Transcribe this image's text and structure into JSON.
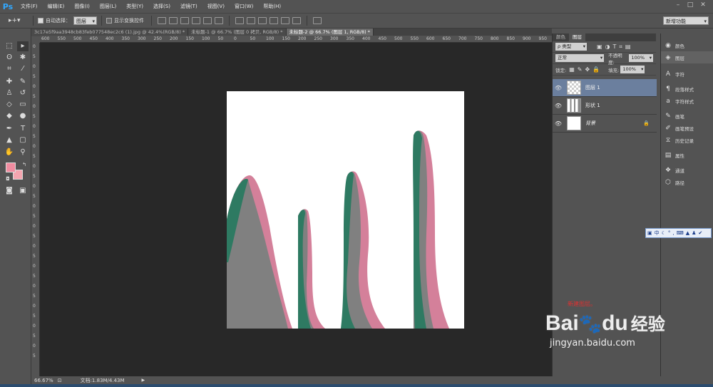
{
  "app": {
    "logo": "Ps"
  },
  "menu": [
    "文件(F)",
    "编辑(E)",
    "图像(I)",
    "图层(L)",
    "类型(Y)",
    "选择(S)",
    "滤镜(T)",
    "视图(V)",
    "窗口(W)",
    "帮助(H)"
  ],
  "options": {
    "auto_select_label": "自动选择：",
    "auto_select_value": "图层",
    "show_transform_label": "显示变换控件",
    "workspace": "新增功能"
  },
  "tabs": [
    {
      "label": "3c17e5f9aa3948cb83feb077548ec2c6 (1).jpg @ 42.4%(RGB/8) *"
    },
    {
      "label": "未标题-1 @ 66.7% (图层 0 拷贝, RGB/8) *"
    },
    {
      "label": "未标题-2 @ 66.7% (图层 1, RGB/8) *"
    }
  ],
  "ruler_top": [
    "600",
    "550",
    "500",
    "450",
    "400",
    "350",
    "300",
    "250",
    "200",
    "150",
    "100",
    "50",
    "0",
    "50",
    "100",
    "150",
    "200",
    "250",
    "300",
    "350",
    "400",
    "450",
    "500",
    "550",
    "600",
    "650",
    "700",
    "750",
    "800",
    "850",
    "900",
    "950"
  ],
  "ruler_left": [
    "0",
    "5",
    "0",
    "5",
    "0",
    "5",
    "0",
    "5",
    "0",
    "5",
    "0",
    "5",
    "0",
    "5",
    "0",
    "5",
    "0",
    "5",
    "0",
    "5",
    "0",
    "5",
    "0",
    "5",
    "0",
    "5",
    "0",
    "5",
    "0",
    "5",
    "0",
    "5"
  ],
  "status": {
    "zoom": "66.67%",
    "doc": "文档:1.83M/4.43M"
  },
  "colors": {
    "foreground": "#f08ca0",
    "background": "#f5a5b0",
    "green": "#2e7a62",
    "pink": "#d4809a",
    "gray": "#808080"
  },
  "layers_panel": {
    "tabs": [
      "颜色",
      "图层"
    ],
    "filter": "ρ 类型",
    "blend_mode": "正常",
    "opacity_label": "不透明度:",
    "opacity": "100%",
    "lock_label": "锁定:",
    "fill_label": "填充:",
    "fill": "100%",
    "layers": [
      {
        "name": "图层 1",
        "selected": true
      },
      {
        "name": "形状 1",
        "selected": false
      },
      {
        "name": "背景",
        "selected": false,
        "locked": true
      }
    ]
  },
  "dock": [
    {
      "icon": "color-icon",
      "label": "颜色"
    },
    {
      "icon": "layers-icon",
      "label": "图层"
    },
    {
      "icon": "character-icon",
      "label": "字符"
    },
    {
      "icon": "paragraph-style-icon",
      "label": "段落样式"
    },
    {
      "icon": "character-style-icon",
      "label": "字符样式"
    },
    {
      "icon": "brush-icon",
      "label": "画笔"
    },
    {
      "icon": "brush-preset-icon",
      "label": "画笔预设"
    },
    {
      "icon": "history-icon",
      "label": "历史记录"
    },
    {
      "icon": "properties-icon",
      "label": "属性"
    },
    {
      "icon": "channels-icon",
      "label": "通道"
    },
    {
      "icon": "paths-icon",
      "label": "路径"
    }
  ],
  "annotation": "新建图层。",
  "watermark": {
    "brand": "Bai",
    "brand2": "du",
    "cn": "经验",
    "url": "jingyan.baidu.com"
  }
}
